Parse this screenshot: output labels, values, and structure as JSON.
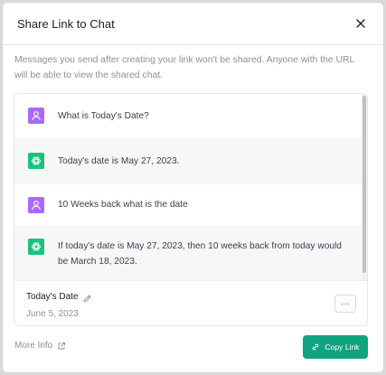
{
  "dialog": {
    "title": "Share Link to Chat",
    "description": "Messages you send after creating your link won't be shared. Anyone with the URL will be able to view the shared chat."
  },
  "conversation": {
    "messages": [
      {
        "role": "user",
        "avatar_icon": "user-icon",
        "text": "What is Today's Date?"
      },
      {
        "role": "assistant",
        "avatar_icon": "openai-logo-icon",
        "text": "Today's date is May 27, 2023."
      },
      {
        "role": "user",
        "avatar_icon": "user-icon",
        "text": "10 Weeks back what is the date"
      },
      {
        "role": "assistant",
        "avatar_icon": "openai-logo-icon",
        "text": "If today's date is May 27, 2023, then 10 weeks back from today would be March 18, 2023."
      }
    ]
  },
  "chat_meta": {
    "title": "Today's Date",
    "date": "June 5, 2023",
    "more_label": "···"
  },
  "footer": {
    "more_info_label": "More Info",
    "copy_link_label": "Copy Link"
  },
  "colors": {
    "accent": "#10a37f",
    "user_avatar": "#ab68ff",
    "assistant_avatar": "#19c37d"
  }
}
